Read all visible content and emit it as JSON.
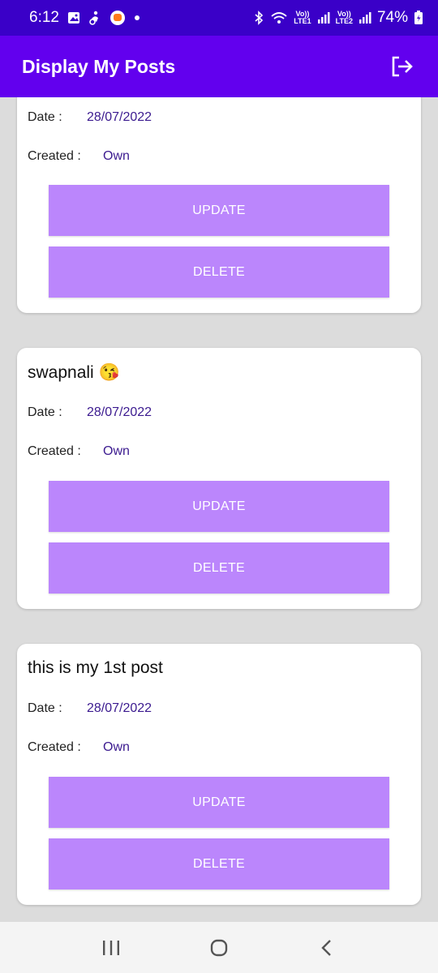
{
  "status_bar": {
    "time": "6:12",
    "battery": "74%",
    "sim1": [
      "Vo))",
      "LTE1"
    ],
    "sim2": [
      "Vo))",
      "LTE2"
    ]
  },
  "app_bar": {
    "title": "Display My Posts"
  },
  "posts": [
    {
      "title": "",
      "date_label": "Date :",
      "date": "28/07/2022",
      "created_label": "Created :",
      "created": "Own",
      "update_label": "UPDATE",
      "delete_label": "DELETE"
    },
    {
      "title": "swapnali 😘",
      "date_label": "Date :",
      "date": "28/07/2022",
      "created_label": "Created :",
      "created": "Own",
      "update_label": "UPDATE",
      "delete_label": "DELETE"
    },
    {
      "title": "this is my 1st post",
      "date_label": "Date :",
      "date": "28/07/2022",
      "created_label": "Created :",
      "created": "Own",
      "update_label": "UPDATE",
      "delete_label": "DELETE"
    }
  ]
}
